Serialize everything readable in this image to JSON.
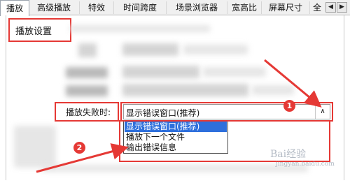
{
  "tabs": [
    {
      "label": "播放",
      "active": true
    },
    {
      "label": "高级播放",
      "active": false
    },
    {
      "label": "特效",
      "active": false
    },
    {
      "label": "时间跨度",
      "active": false
    },
    {
      "label": "场景浏览器",
      "active": false
    },
    {
      "label": "宽高比",
      "active": false
    },
    {
      "label": "屏幕尺寸",
      "active": false
    },
    {
      "label": "全",
      "active": false
    }
  ],
  "tab_scroll": {
    "left_icon": "chevron-left-icon",
    "right_icon": "chevron-right-icon"
  },
  "section": {
    "title": "播放设置"
  },
  "playback_failure": {
    "label": "播放失败时:",
    "selected": "显示错误窗口(推荐)",
    "options": [
      "显示错误窗口(推荐)",
      "播放下一个文件",
      "输出错误信息"
    ]
  },
  "annotations": {
    "badge1": "1",
    "badge2": "2"
  },
  "watermark": {
    "brand": "Bai经验",
    "url": "jingyan.baidu.com"
  },
  "colors": {
    "highlight": "#e53935",
    "selection": "#2d6fdc"
  }
}
